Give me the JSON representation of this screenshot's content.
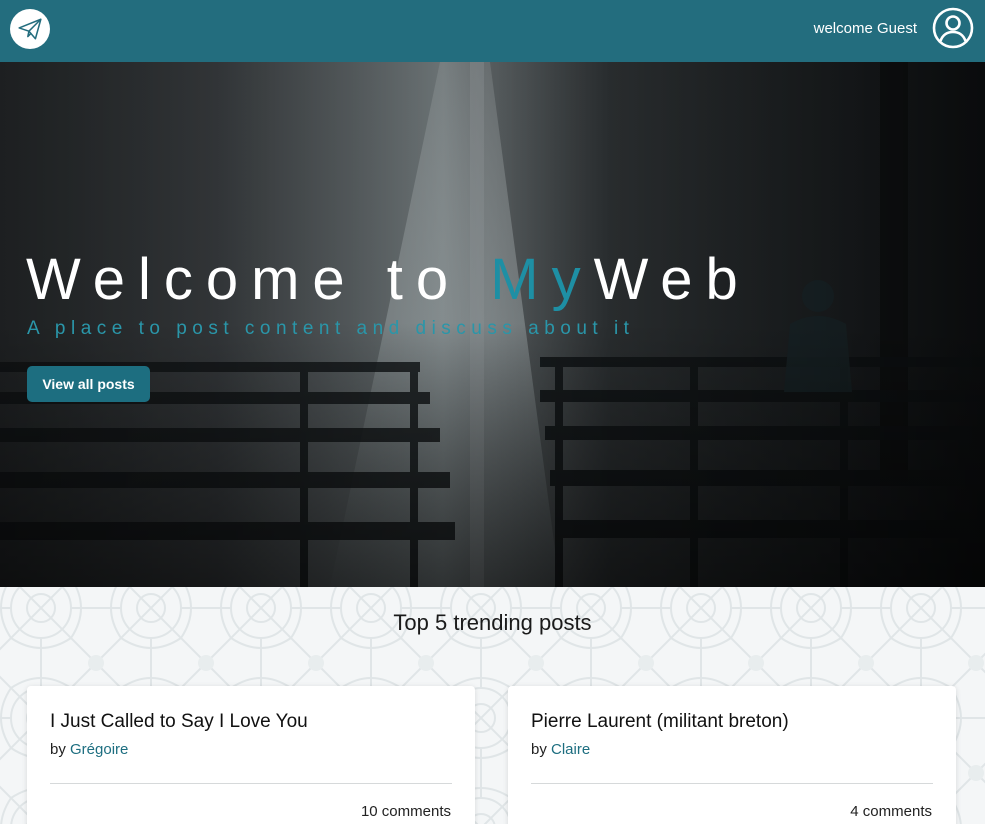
{
  "header": {
    "logo_icon": "paper-plane-icon",
    "welcome_text": "welcome Guest",
    "user_icon": "user-circle-icon",
    "background_color": "#236d7e"
  },
  "hero": {
    "title_part1": "Welcome to ",
    "title_accent": "My",
    "title_part2": "Web",
    "subtitle": "A place to post content and discuss about it",
    "button_label": "View all posts",
    "accent_color": "#1e8fa4"
  },
  "trending": {
    "title": "Top 5 trending posts",
    "by_label": "by",
    "posts": [
      {
        "title": "I Just Called to Say I Love You",
        "author": "Grégoire",
        "comments": "10 comments"
      },
      {
        "title": "Pierre Laurent (militant breton)",
        "author": "Claire",
        "comments": "4 comments"
      }
    ]
  }
}
